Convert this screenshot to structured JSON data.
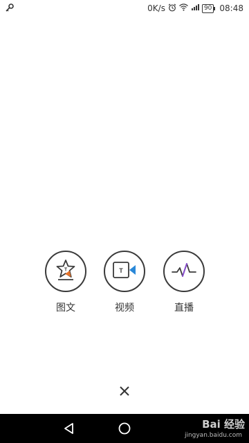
{
  "status_bar": {
    "network_speed": "0K/s",
    "battery": "90",
    "time": "08:48"
  },
  "actions": [
    {
      "label": "图文",
      "icon": "star-text-icon"
    },
    {
      "label": "视频",
      "icon": "video-camera-icon"
    },
    {
      "label": "直播",
      "icon": "live-wave-icon"
    }
  ],
  "close": {
    "icon": "close-icon"
  },
  "nav_bar": {
    "back_icon": "back-triangle-icon",
    "home_icon": "home-circle-icon"
  },
  "watermark": {
    "text": "Bai 经验",
    "sub": "jingyan.baidu.com"
  },
  "colors": {
    "accent_orange": "#e8742a",
    "accent_blue": "#2a88d8",
    "accent_purple": "#8a4fd0",
    "icon_stroke": "#3a3a3a"
  }
}
